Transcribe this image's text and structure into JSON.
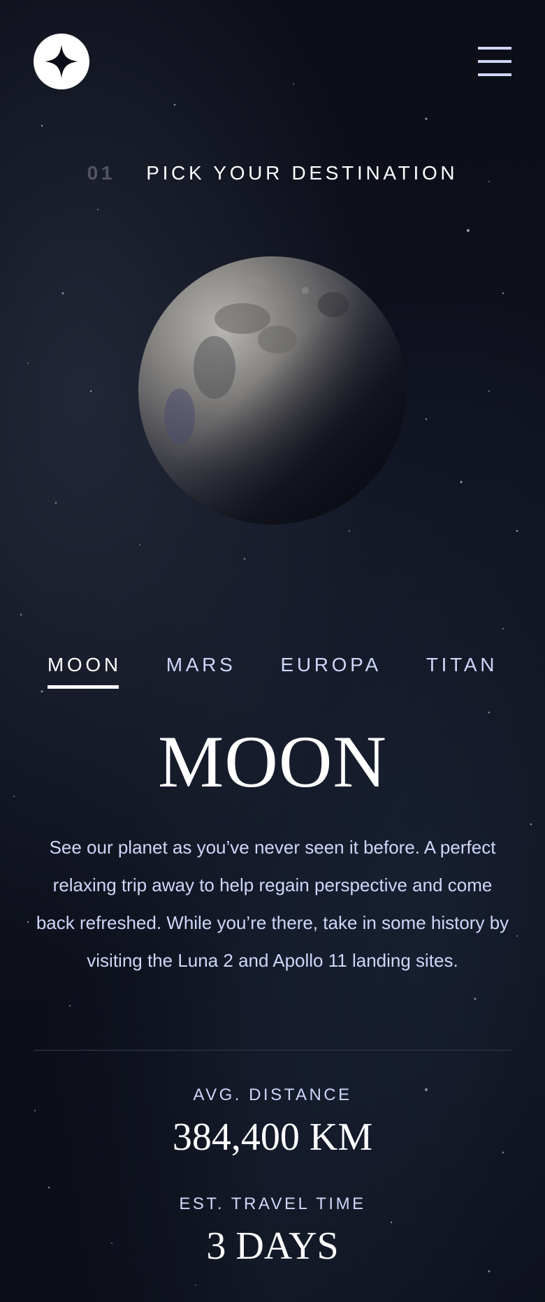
{
  "header": {
    "logo_icon": "star-logo-icon",
    "menu_icon": "hamburger-menu-icon"
  },
  "eyebrow": {
    "number": "01",
    "label": "PICK YOUR DESTINATION"
  },
  "destination_image": "moon-image",
  "tabs": [
    {
      "label": "MOON",
      "active": true
    },
    {
      "label": "MARS",
      "active": false
    },
    {
      "label": "EUROPA",
      "active": false
    },
    {
      "label": "TITAN",
      "active": false
    }
  ],
  "destination": {
    "name": "MOON",
    "description": "See our planet as you’ve never seen it before. A perfect relaxing trip away to help regain perspective and come back refreshed. While you’re there, take in some history by visiting the Luna 2 and Apollo 11 landing sites."
  },
  "stats": {
    "distance_label": "AVG. DISTANCE",
    "distance_value": "384,400 KM",
    "travel_label": "EST. TRAVEL TIME",
    "travel_value": "3 DAYS"
  },
  "colors": {
    "background": "#0b0d17",
    "accent": "#d0d6f9",
    "white": "#ffffff"
  }
}
